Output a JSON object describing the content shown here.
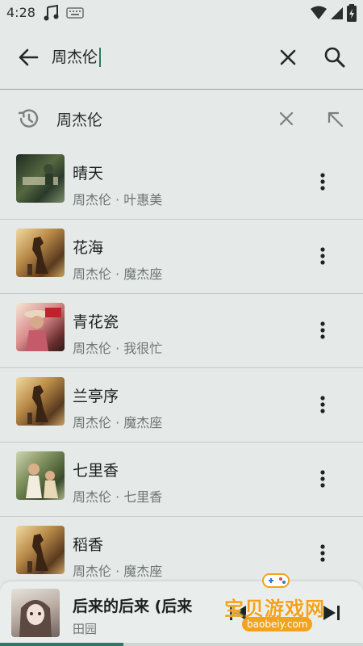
{
  "status": {
    "time": "4:28"
  },
  "search": {
    "query": "周杰伦"
  },
  "history": {
    "text": "周杰伦"
  },
  "songs": [
    {
      "title": "晴天",
      "subtitle": "周杰伦 · 叶惠美"
    },
    {
      "title": "花海",
      "subtitle": "周杰伦 · 魔杰座"
    },
    {
      "title": "青花瓷",
      "subtitle": "周杰伦 · 我很忙"
    },
    {
      "title": "兰亭序",
      "subtitle": "周杰伦 · 魔杰座"
    },
    {
      "title": "七里香",
      "subtitle": "周杰伦 · 七里香"
    },
    {
      "title": "稻香",
      "subtitle": "周杰伦 · 魔杰座"
    }
  ],
  "player": {
    "title": "后来的后来 (后来",
    "artist": "田园",
    "progress": 0.34
  },
  "watermark": {
    "title": "宝贝游戏网",
    "url": "baobeiy.com"
  },
  "colors": {
    "background": "#e5eae8",
    "accent": "#2c7a67",
    "watermark": "#f2a21b"
  },
  "icons": {
    "back": "arrow-left-icon",
    "clear": "close-icon",
    "search": "search-icon",
    "history": "history-icon",
    "fill": "arrow-up-left-icon",
    "more": "more-vert-icon"
  }
}
